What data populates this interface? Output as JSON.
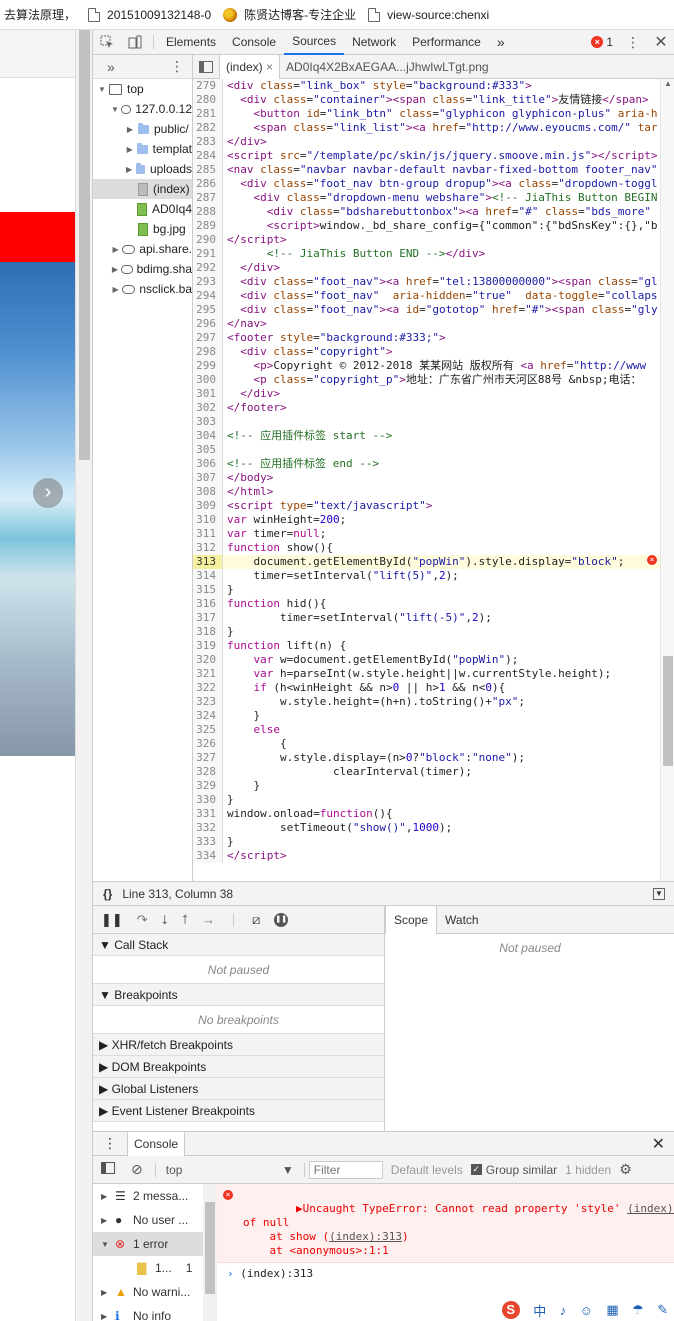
{
  "bookmarks": [
    {
      "label": "去算法原理，"
    },
    {
      "label": "20151009132148-0"
    },
    {
      "label": "陈贤达博客-专注企业"
    },
    {
      "label": "view-source:chenxi"
    }
  ],
  "devtools": {
    "tabs": [
      "Elements",
      "Console",
      "Sources",
      "Network",
      "Performance"
    ],
    "more": "»",
    "error_count": "1",
    "navigator": {
      "more": "»",
      "tree": [
        {
          "label": "top",
          "depth": 0,
          "kind": "frame",
          "open": true
        },
        {
          "label": "127.0.0.12",
          "depth": 1,
          "kind": "cloud",
          "open": true
        },
        {
          "label": "public/",
          "depth": 2,
          "kind": "folder"
        },
        {
          "label": "templat",
          "depth": 2,
          "kind": "folder"
        },
        {
          "label": "uploads",
          "depth": 2,
          "kind": "folder"
        },
        {
          "label": "(index)",
          "depth": 2,
          "kind": "file-grey",
          "selected": true
        },
        {
          "label": "AD0Iq4",
          "depth": 2,
          "kind": "file-green"
        },
        {
          "label": "bg.jpg",
          "depth": 2,
          "kind": "file-green"
        },
        {
          "label": "api.share.",
          "depth": 1,
          "kind": "cloud"
        },
        {
          "label": "bdimg.sha",
          "depth": 1,
          "kind": "cloud"
        },
        {
          "label": "nsclick.ba",
          "depth": 1,
          "kind": "cloud"
        }
      ]
    },
    "editor": {
      "tabs": [
        "(index)",
        "AD0Iq4X2BxAEGAA...jJhwIwLTgt.png"
      ],
      "close": "×",
      "status": "Line 313, Column 38",
      "braces": "{}",
      "lines": [
        {
          "n": "279",
          "html": "<span class='t-tag'>&lt;div</span> <span class='t-attr'>class</span>=<span class='t-str'>\"link_box\"</span> <span class='t-attr'>style</span>=<span class='t-str'>\"background:#333\"</span><span class='t-tag'>&gt;</span>"
        },
        {
          "n": "280",
          "html": "  <span class='t-tag'>&lt;div</span> <span class='t-attr'>class</span>=<span class='t-str'>\"container\"</span><span class='t-tag'>&gt;&lt;span</span> <span class='t-attr'>class</span>=<span class='t-str'>\"link_title\"</span><span class='t-tag'>&gt;</span>友情链接<span class='t-tag'>&lt;/span&gt;</span>"
        },
        {
          "n": "281",
          "html": "    <span class='t-tag'>&lt;button</span> <span class='t-attr'>id</span>=<span class='t-str'>\"link_btn\"</span> <span class='t-attr'>class</span>=<span class='t-str'>\"glyphicon glyphicon-plus\"</span> <span class='t-attr'>aria-h</span>"
        },
        {
          "n": "282",
          "html": "    <span class='t-tag'>&lt;span</span> <span class='t-attr'>class</span>=<span class='t-str'>\"link_list\"</span><span class='t-tag'>&gt;&lt;a</span> <span class='t-attr'>href</span>=<span class='t-str'>\"http://www.eyoucms.com/\"</span> <span class='t-attr'>tar</span>"
        },
        {
          "n": "283",
          "html": "<span class='t-tag'>&lt;/div&gt;</span>"
        },
        {
          "n": "284",
          "html": "<span class='t-tag'>&lt;script</span> <span class='t-attr'>src</span>=<span class='t-str'>\"/template/pc/skin/js/jquery.smoove.min.js\"</span><span class='t-tag'>&gt;&lt;/script&gt;</span>"
        },
        {
          "n": "285",
          "html": "<span class='t-tag'>&lt;nav</span> <span class='t-attr'>class</span>=<span class='t-str'>\"navbar navbar-default navbar-fixed-bottom footer_nav\"</span>"
        },
        {
          "n": "286",
          "html": "  <span class='t-tag'>&lt;div</span> <span class='t-attr'>class</span>=<span class='t-str'>\"foot_nav btn-group dropup\"</span><span class='t-tag'>&gt;&lt;a</span> <span class='t-attr'>class</span>=<span class='t-str'>\"dropdown-toggl</span>"
        },
        {
          "n": "287",
          "html": "    <span class='t-tag'>&lt;div</span> <span class='t-attr'>class</span>=<span class='t-str'>\"dropdown-menu webshare\"</span><span class='t-tag'>&gt;</span><span class='t-com'>&lt;!-- JiaThis Button BEGIN</span>"
        },
        {
          "n": "288",
          "html": "      <span class='t-tag'>&lt;div</span> <span class='t-attr'>class</span>=<span class='t-str'>\"bdsharebuttonbox\"</span><span class='t-tag'>&gt;&lt;a</span> <span class='t-attr'>href</span>=<span class='t-str'>\"#\"</span> <span class='t-attr'>class</span>=<span class='t-str'>\"bds_more\"</span>"
        },
        {
          "n": "289",
          "html": "      <span class='t-tag'>&lt;script&gt;</span>window._bd_share_config={\"common\":{\"bdSnsKey\":{},\"b"
        },
        {
          "n": "290",
          "html": "<span class='t-tag'>&lt;/script&gt;</span>"
        },
        {
          "n": "291",
          "html": "      <span class='t-com'>&lt;!-- JiaThis Button END --&gt;</span><span class='t-tag'>&lt;/div&gt;</span>"
        },
        {
          "n": "292",
          "html": "  <span class='t-tag'>&lt;/div&gt;</span>"
        },
        {
          "n": "293",
          "html": "  <span class='t-tag'>&lt;div</span> <span class='t-attr'>class</span>=<span class='t-str'>\"foot_nav\"</span><span class='t-tag'>&gt;&lt;a</span> <span class='t-attr'>href</span>=<span class='t-str'>\"tel:13800000000\"</span><span class='t-tag'>&gt;&lt;span</span> <span class='t-attr'>class</span>=<span class='t-str'>\"gl</span>"
        },
        {
          "n": "294",
          "html": "  <span class='t-tag'>&lt;div</span> <span class='t-attr'>class</span>=<span class='t-str'>\"foot_nav\"</span>  <span class='t-attr'>aria-hidden</span>=<span class='t-str'>\"true\"</span>  <span class='t-attr'>data-toggle</span>=<span class='t-str'>\"collaps</span>"
        },
        {
          "n": "295",
          "html": "  <span class='t-tag'>&lt;div</span> <span class='t-attr'>class</span>=<span class='t-str'>\"foot_nav\"</span><span class='t-tag'>&gt;&lt;a</span> <span class='t-attr'>id</span>=<span class='t-str'>\"gototop\"</span> <span class='t-attr'>href</span>=<span class='t-str'>\"#\"</span><span class='t-tag'>&gt;&lt;span</span> <span class='t-attr'>class</span>=<span class='t-str'>\"gly</span>"
        },
        {
          "n": "296",
          "html": "<span class='t-tag'>&lt;/nav&gt;</span>"
        },
        {
          "n": "297",
          "html": "<span class='t-tag'>&lt;footer</span> <span class='t-attr'>style</span>=<span class='t-str'>\"background:#333;\"</span><span class='t-tag'>&gt;</span>"
        },
        {
          "n": "298",
          "html": "  <span class='t-tag'>&lt;div</span> <span class='t-attr'>class</span>=<span class='t-str'>\"copyright\"</span><span class='t-tag'>&gt;</span>"
        },
        {
          "n": "299",
          "html": "    <span class='t-tag'>&lt;p&gt;</span>Copyright © 2012-2018 某某网站 版权所有 <span class='t-tag'>&lt;a</span> <span class='t-attr'>href</span>=<span class='t-str'>\"http://www</span>"
        },
        {
          "n": "300",
          "html": "    <span class='t-tag'>&lt;p</span> <span class='t-attr'>class</span>=<span class='t-str'>\"copyright_p\"</span><span class='t-tag'>&gt;</span>地址：广东省广州市天河区88号 &amp;nbsp;电话："
        },
        {
          "n": "301",
          "html": "  <span class='t-tag'>&lt;/div&gt;</span>"
        },
        {
          "n": "302",
          "html": "<span class='t-tag'>&lt;/footer&gt;</span>"
        },
        {
          "n": "303",
          "html": ""
        },
        {
          "n": "304",
          "html": "<span class='t-com'>&lt;!-- 应用插件标签 start --&gt;</span>"
        },
        {
          "n": "305",
          "html": ""
        },
        {
          "n": "306",
          "html": "<span class='t-com'>&lt;!-- 应用插件标签 end --&gt;</span>"
        },
        {
          "n": "307",
          "html": "<span class='t-tag'>&lt;/body&gt;</span>"
        },
        {
          "n": "308",
          "html": "<span class='t-tag'>&lt;/html&gt;</span>"
        },
        {
          "n": "309",
          "html": "<span class='t-tag'>&lt;script</span> <span class='t-attr'>type</span>=<span class='t-str'>\"text/javascript\"</span><span class='t-tag'>&gt;</span>"
        },
        {
          "n": "310",
          "html": "<span class='t-kw'>var</span> winHeight=<span class='t-num'>200</span>;"
        },
        {
          "n": "311",
          "html": "<span class='t-kw'>var</span> timer=<span class='t-kw'>null</span>;"
        },
        {
          "n": "312",
          "html": "<span class='t-kw'>function</span> show(){"
        },
        {
          "n": "313",
          "html": "    document.getElementById(<span class='t-str'>\"popWin\"</span>).style.display=<span class='t-str'>\"block\"</span>;",
          "highlight": true
        },
        {
          "n": "314",
          "html": "    timer=setInterval(<span class='t-str'>\"lift(5)\"</span>,<span class='t-num'>2</span>);"
        },
        {
          "n": "315",
          "html": "}"
        },
        {
          "n": "316",
          "html": "<span class='t-kw'>function</span> hid(){"
        },
        {
          "n": "317",
          "html": "        timer=setInterval(<span class='t-str'>\"lift(-5)\"</span>,<span class='t-num'>2</span>);"
        },
        {
          "n": "318",
          "html": "}"
        },
        {
          "n": "319",
          "html": "<span class='t-kw'>function</span> lift(n) {"
        },
        {
          "n": "320",
          "html": "    <span class='t-kw'>var</span> w=document.getElementById(<span class='t-str'>\"popWin\"</span>);"
        },
        {
          "n": "321",
          "html": "    <span class='t-kw'>var</span> h=parseInt(w.style.height||w.currentStyle.height);"
        },
        {
          "n": "322",
          "html": "    <span class='t-kw'>if</span> (h&lt;winHeight &amp;&amp; n&gt;<span class='t-num'>0</span> || h&gt;<span class='t-num'>1</span> &amp;&amp; n&lt;<span class='t-num'>0</span>){"
        },
        {
          "n": "323",
          "html": "        w.style.height=(h+n).toString()+<span class='t-str'>\"px\"</span>;"
        },
        {
          "n": "324",
          "html": "    }"
        },
        {
          "n": "325",
          "html": "    <span class='t-kw'>else</span>"
        },
        {
          "n": "326",
          "html": "        {"
        },
        {
          "n": "327",
          "html": "        w.style.display=(n&gt;<span class='t-num'>0</span>?<span class='t-str'>\"block\"</span>:<span class='t-str'>\"none\"</span>);"
        },
        {
          "n": "328",
          "html": "                clearInterval(timer);"
        },
        {
          "n": "329",
          "html": "    }"
        },
        {
          "n": "330",
          "html": "}"
        },
        {
          "n": "331",
          "html": "window.onload=<span class='t-kw'>function</span>(){"
        },
        {
          "n": "332",
          "html": "        setTimeout(<span class='t-str'>\"show()\"</span>,<span class='t-num'>1000</span>);"
        },
        {
          "n": "333",
          "html": "}"
        },
        {
          "n": "334",
          "html": "<span class='t-tag'>&lt;/script&gt;</span>"
        }
      ]
    },
    "debugger": {
      "call_stack": "Call Stack",
      "not_paused": "Not paused",
      "breakpoints": "Breakpoints",
      "no_breakpoints": "No breakpoints",
      "xhr": "XHR/fetch Breakpoints",
      "dom": "DOM Breakpoints",
      "global": "Global Listeners",
      "event": "Event Listener Breakpoints",
      "scope_tabs": [
        "Scope",
        "Watch"
      ],
      "scope_not_paused": "Not paused"
    },
    "console": {
      "tab": "Console",
      "context": "top",
      "filter_placeholder": "Filter",
      "levels": "Default levels",
      "group_similar": "Group similar",
      "hidden": "1 hidden",
      "sidebar": [
        {
          "icon": "list",
          "label": "2 messa..."
        },
        {
          "icon": "user",
          "label": "No user ..."
        },
        {
          "icon": "error",
          "label": "1 error",
          "selected": true
        },
        {
          "icon": "file",
          "label": "1...",
          "count": "1"
        },
        {
          "icon": "warning",
          "label": "No warni..."
        },
        {
          "icon": "info",
          "label": "No info"
        }
      ],
      "error_line1": "Uncaught TypeError: Cannot read property 'style'",
      "error_link": "(index):313",
      "error_line2": "of null",
      "error_line3a": "    at show (",
      "error_line3link": "(index):313",
      "error_line3b": ")",
      "error_line4": "    at <anonymous>:1:1",
      "prompt_text": "(index):313"
    },
    "ime": [
      "S",
      "中",
      "♪",
      "☺",
      "▦",
      "☂",
      "✎"
    ]
  },
  "colors": {
    "accent": "#1a73e8",
    "error": "#e32222",
    "highlight": "#fffbdd"
  }
}
